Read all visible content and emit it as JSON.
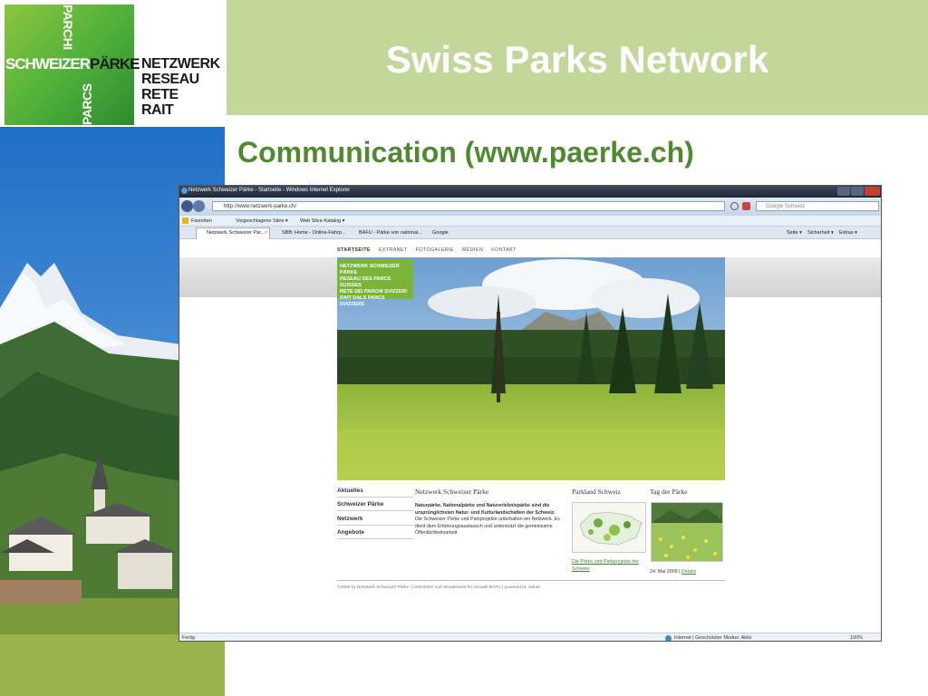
{
  "logo": {
    "vertical_top": "PARCHI",
    "vertical_bottom": "PARCS",
    "schweizer": "SCHWEIZER",
    "paerke": "PÄRKE",
    "words": [
      "NETZWERK",
      "RESEAU",
      "RETE",
      "RAIT"
    ]
  },
  "slide": {
    "title": "Swiss Parks Network",
    "subtitle": "Communication (www.paerke.ch)"
  },
  "browser": {
    "window_title": "Netzwerk Schweizer Pärke - Startseite - Windows Internet Explorer",
    "url": "http://www.netzwerk-parke.ch/",
    "search_placeholder": "Google Schweiz",
    "favorites": {
      "favoriten": "Favoriten",
      "vorgeschlagene": "Vorgeschlagene Sites ▾",
      "webslice": "Web Slice-Katalog ▾"
    },
    "tabs": [
      "Netzwerk Schweizer Pär...",
      "SBB: Home - Online-Fahrp...",
      "BAFU - Pärke von national...",
      "Google"
    ],
    "toolbar_right": {
      "seite": "Seite ▾",
      "sicherheit": "Sicherheit ▾",
      "extras": "Extras ▾"
    },
    "status_left": "Fertig",
    "status_zone": "Internet | Geschützter Modus: Aktiv",
    "zoom": "100%"
  },
  "site": {
    "topnav": [
      "STARTSEITE",
      "EXTRANET",
      "FOTOGALERIE",
      "MEDIEN",
      "KONTAKT"
    ],
    "hero_logo": [
      "NETZWERK SCHWEIZER PÄRKE",
      "RESEAU DES PARCS SUISSES",
      "RETE DEI PARCHI SVIZZERI",
      "RAIT DALS PARCS SVIZZERS"
    ],
    "leftnav": [
      "Aktuelles",
      "Schweizer Pärke",
      "Netzwerk",
      "Angebote"
    ],
    "col_network_title": "Netzwerk Schweizer Pärke",
    "intro_bold": "Naturpärke, Nationalpärke und Naturerlebnispärke sind die ursprünglichsten Natur- und Kulturlandschaften der Schweiz.",
    "intro_text": "Die Schweizer Pärke und Parkprojekte unterhalten ein Netzwerk. Es dient dem Erfahrungsaustausch und unterstützt die gemeinsame Öffentlichkeitsarbeit.",
    "col_parkland_title": "Parkland Schweiz",
    "parkland_link": "Die Pärke und Parkprojekte der Schweiz",
    "col_day_title": "Tag der Pärke",
    "day_date": "24. Mai 2009 |",
    "day_link": "Details",
    "footer": "©2009 by Netzwerk Schweizer Pärke | Unterstützt vom Bundesamt für Umwelt BAFU | powered by indual"
  }
}
